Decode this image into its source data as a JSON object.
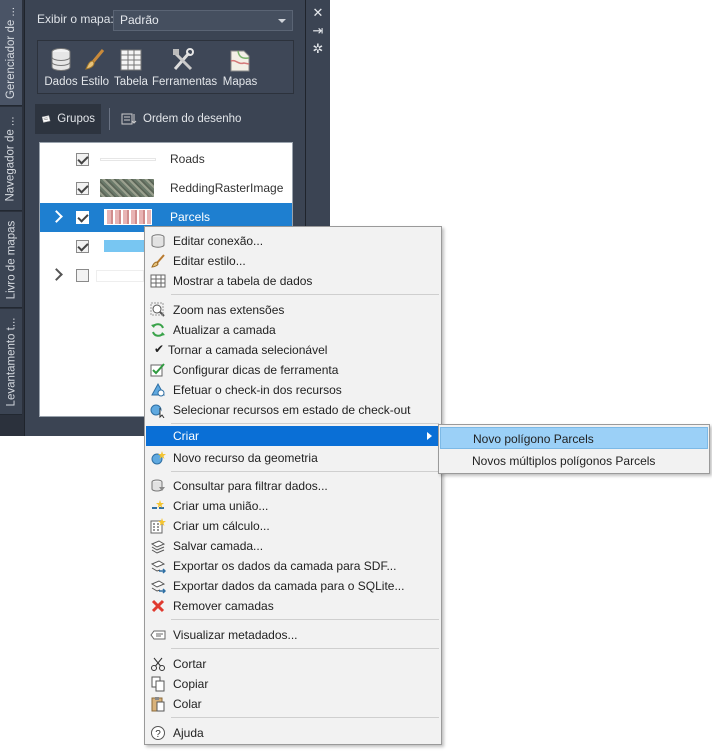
{
  "palette": {
    "vtabs": [
      "Gerenciador de ...",
      "Navegador de ...",
      "Livro de mapas",
      "Levantamento t..."
    ],
    "map_label": "Exibir o mapa:",
    "map_value": "Padrão",
    "toolbar": {
      "dados": "Dados",
      "estilo": "Estilo",
      "tabela": "Tabela",
      "ferramentas": "Ferramentas",
      "mapas": "Mapas"
    },
    "tabs": {
      "grupos": "Grupos",
      "ordem": "Ordem do desenho"
    },
    "layers": [
      {
        "name": "Roads",
        "checked": true,
        "selected": false
      },
      {
        "name": "ReddingRasterImage",
        "checked": true,
        "selected": false
      },
      {
        "name": "Parcels",
        "checked": true,
        "selected": true
      },
      {
        "name": "",
        "checked": true,
        "selected": false
      },
      {
        "name": "",
        "checked": false,
        "selected": false
      }
    ]
  },
  "context_menu": {
    "editar_conexao": "Editar conexão...",
    "editar_estilo": "Editar estilo...",
    "mostrar_tabela": "Mostrar a tabela de dados",
    "zoom_extensoes": "Zoom nas extensões",
    "atualizar_camada": "Atualizar a camada",
    "tornar_selecionavel": "Tornar a camada selecionável",
    "configurar_dicas": "Configurar dicas de ferramenta",
    "checkin": "Efetuar o check-in dos recursos",
    "selecionar_checkout": "Selecionar recursos em estado de check-out",
    "criar": "Criar",
    "novo_recurso": "Novo recurso da geometria",
    "consultar": "Consultar para filtrar dados...",
    "criar_uniao": "Criar uma união...",
    "criar_calculo": "Criar um cálculo...",
    "salvar_camada": "Salvar camada...",
    "exportar_sdf": "Exportar os dados da camada para SDF...",
    "exportar_sqlite": "Exportar dados da camada para o SQLite...",
    "remover_camadas": "Remover camadas",
    "visualizar_metadados": "Visualizar metadados...",
    "cortar": "Cortar",
    "copiar": "Copiar",
    "colar": "Colar",
    "ajuda": "Ajuda"
  },
  "submenu": {
    "novo_poligono": "Novo polígono Parcels",
    "novos_multiplos": "Novos múltiplos polígonos Parcels"
  },
  "colors": {
    "palette_bg": "#3b4453",
    "selection": "#1e7fd0",
    "menu_highlight": "#0a6fd6",
    "submenu_highlight": "#9bd0f7"
  }
}
